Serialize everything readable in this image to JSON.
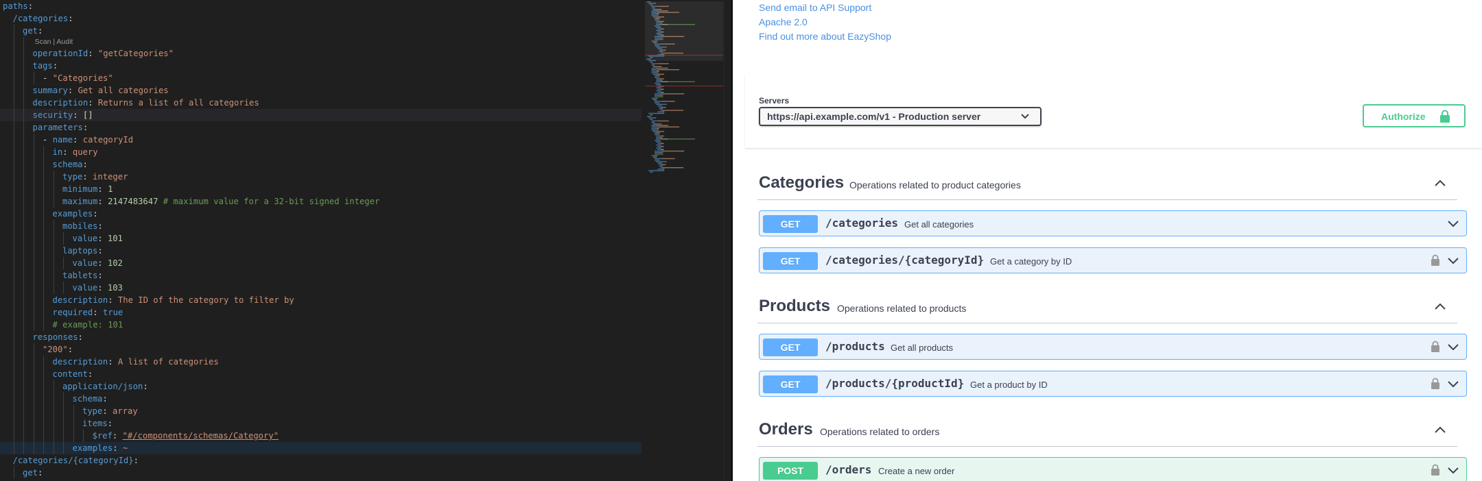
{
  "editor": {
    "codelens": "Scan | Audit",
    "lines": [
      {
        "indent": 0,
        "guides": [],
        "tokens": [
          [
            "k",
            "paths"
          ],
          [
            "p",
            ":"
          ]
        ]
      },
      {
        "indent": 1,
        "guides": [],
        "tokens": [
          [
            "k",
            "/categories"
          ],
          [
            "p",
            ":"
          ]
        ]
      },
      {
        "indent": 2,
        "guides": [
          1
        ],
        "tokens": [
          [
            "k",
            "get"
          ],
          [
            "p",
            ":"
          ]
        ]
      },
      {
        "codelens": true
      },
      {
        "indent": 3,
        "guides": [
          1,
          2
        ],
        "tokens": [
          [
            "k",
            "operationId"
          ],
          [
            "p",
            ": "
          ],
          [
            "s",
            "\"getCategories\""
          ]
        ]
      },
      {
        "indent": 3,
        "guides": [
          1,
          2
        ],
        "tokens": [
          [
            "k",
            "tags"
          ],
          [
            "p",
            ":"
          ]
        ]
      },
      {
        "indent": 4,
        "guides": [
          1,
          2,
          3
        ],
        "tokens": [
          [
            "p",
            "- "
          ],
          [
            "s",
            "\"Categories\""
          ]
        ]
      },
      {
        "indent": 3,
        "guides": [
          1,
          2
        ],
        "tokens": [
          [
            "k",
            "summary"
          ],
          [
            "p",
            ": "
          ],
          [
            "s",
            "Get all categories"
          ]
        ]
      },
      {
        "indent": 3,
        "guides": [
          1,
          2
        ],
        "tokens": [
          [
            "k",
            "description"
          ],
          [
            "p",
            ": "
          ],
          [
            "s",
            "Returns a list of all categories"
          ]
        ]
      },
      {
        "indent": 3,
        "guides": [
          1,
          2
        ],
        "hl": true,
        "tokens": [
          [
            "k",
            "security"
          ],
          [
            "p",
            ": "
          ],
          [
            "b",
            "[]"
          ]
        ]
      },
      {
        "indent": 3,
        "guides": [
          1,
          2
        ],
        "tokens": [
          [
            "k",
            "parameters"
          ],
          [
            "p",
            ":"
          ]
        ]
      },
      {
        "indent": 4,
        "guides": [
          1,
          2,
          3
        ],
        "tokens": [
          [
            "p",
            "- "
          ],
          [
            "k",
            "name"
          ],
          [
            "p",
            ": "
          ],
          [
            "s",
            "categoryId"
          ]
        ]
      },
      {
        "indent": 5,
        "guides": [
          1,
          2,
          3,
          4
        ],
        "tokens": [
          [
            "k",
            "in"
          ],
          [
            "p",
            ": "
          ],
          [
            "s",
            "query"
          ]
        ]
      },
      {
        "indent": 5,
        "guides": [
          1,
          2,
          3,
          4
        ],
        "tokens": [
          [
            "k",
            "schema"
          ],
          [
            "p",
            ":"
          ]
        ]
      },
      {
        "indent": 6,
        "guides": [
          1,
          2,
          3,
          4,
          5
        ],
        "tokens": [
          [
            "k",
            "type"
          ],
          [
            "p",
            ": "
          ],
          [
            "s",
            "integer"
          ]
        ]
      },
      {
        "indent": 6,
        "guides": [
          1,
          2,
          3,
          4,
          5
        ],
        "tokens": [
          [
            "k",
            "minimum"
          ],
          [
            "p",
            ": "
          ],
          [
            "n",
            "1"
          ]
        ]
      },
      {
        "indent": 6,
        "guides": [
          1,
          2,
          3,
          4,
          5
        ],
        "tokens": [
          [
            "k",
            "maximum"
          ],
          [
            "p",
            ": "
          ],
          [
            "n",
            "2147483647"
          ],
          [
            "p",
            " "
          ],
          [
            "c",
            "# maximum value for a 32-bit signed integer"
          ]
        ]
      },
      {
        "indent": 5,
        "guides": [
          1,
          2,
          3,
          4
        ],
        "tokens": [
          [
            "k",
            "examples"
          ],
          [
            "p",
            ":"
          ]
        ]
      },
      {
        "indent": 6,
        "guides": [
          1,
          2,
          3,
          4,
          5
        ],
        "tokens": [
          [
            "k",
            "mobiles"
          ],
          [
            "p",
            ":"
          ]
        ]
      },
      {
        "indent": 7,
        "guides": [
          1,
          2,
          3,
          4,
          5,
          6
        ],
        "tokens": [
          [
            "k",
            "value"
          ],
          [
            "p",
            ": "
          ],
          [
            "n",
            "101"
          ]
        ]
      },
      {
        "indent": 6,
        "guides": [
          1,
          2,
          3,
          4,
          5
        ],
        "tokens": [
          [
            "k",
            "laptops"
          ],
          [
            "p",
            ":"
          ]
        ]
      },
      {
        "indent": 7,
        "guides": [
          1,
          2,
          3,
          4,
          5,
          6
        ],
        "tokens": [
          [
            "k",
            "value"
          ],
          [
            "p",
            ": "
          ],
          [
            "n",
            "102"
          ]
        ]
      },
      {
        "indent": 6,
        "guides": [
          1,
          2,
          3,
          4,
          5
        ],
        "tokens": [
          [
            "k",
            "tablets"
          ],
          [
            "p",
            ":"
          ]
        ]
      },
      {
        "indent": 7,
        "guides": [
          1,
          2,
          3,
          4,
          5,
          6
        ],
        "tokens": [
          [
            "k",
            "value"
          ],
          [
            "p",
            ": "
          ],
          [
            "n",
            "103"
          ]
        ]
      },
      {
        "indent": 5,
        "guides": [
          1,
          2,
          3,
          4
        ],
        "tokens": [
          [
            "k",
            "description"
          ],
          [
            "p",
            ": "
          ],
          [
            "s",
            "The ID of the category to filter by"
          ]
        ]
      },
      {
        "indent": 5,
        "guides": [
          1,
          2,
          3,
          4
        ],
        "tokens": [
          [
            "k",
            "required"
          ],
          [
            "p",
            ": "
          ],
          [
            "k",
            "true"
          ]
        ]
      },
      {
        "indent": 5,
        "guides": [
          1,
          2,
          3,
          4
        ],
        "tokens": [
          [
            "c",
            "# example: 101"
          ]
        ]
      },
      {
        "indent": 3,
        "guides": [
          1,
          2
        ],
        "tokens": [
          [
            "k",
            "responses"
          ],
          [
            "p",
            ":"
          ]
        ]
      },
      {
        "indent": 4,
        "guides": [
          1,
          2,
          3
        ],
        "tokens": [
          [
            "s",
            "\"200\""
          ],
          [
            "p",
            ":"
          ]
        ]
      },
      {
        "indent": 5,
        "guides": [
          1,
          2,
          3,
          4
        ],
        "tokens": [
          [
            "k",
            "description"
          ],
          [
            "p",
            ": "
          ],
          [
            "s",
            "A list of categories"
          ]
        ]
      },
      {
        "indent": 5,
        "guides": [
          1,
          2,
          3,
          4
        ],
        "tokens": [
          [
            "k",
            "content"
          ],
          [
            "p",
            ":"
          ]
        ]
      },
      {
        "indent": 6,
        "guides": [
          1,
          2,
          3,
          4,
          5
        ],
        "tokens": [
          [
            "k",
            "application/json"
          ],
          [
            "p",
            ":"
          ]
        ]
      },
      {
        "indent": 7,
        "guides": [
          1,
          2,
          3,
          4,
          5,
          6
        ],
        "tokens": [
          [
            "k",
            "schema"
          ],
          [
            "p",
            ":"
          ]
        ]
      },
      {
        "indent": 8,
        "guides": [
          1,
          2,
          3,
          4,
          5,
          6,
          7
        ],
        "tokens": [
          [
            "k",
            "type"
          ],
          [
            "p",
            ": "
          ],
          [
            "s",
            "array"
          ]
        ]
      },
      {
        "indent": 8,
        "guides": [
          1,
          2,
          3,
          4,
          5,
          6,
          7
        ],
        "tokens": [
          [
            "k",
            "items"
          ],
          [
            "p",
            ":"
          ]
        ]
      },
      {
        "indent": 9,
        "guides": [
          1,
          2,
          3,
          4,
          5,
          6,
          7,
          8
        ],
        "tokens": [
          [
            "k",
            "$ref"
          ],
          [
            "p",
            ": "
          ],
          [
            "su",
            "\"#/components/schemas/Category\""
          ]
        ]
      },
      {
        "indent": 7,
        "guides": [
          1,
          2,
          3,
          4,
          5,
          6
        ],
        "cur": true,
        "tokens": [
          [
            "k",
            "examples"
          ],
          [
            "p",
            ": "
          ],
          [
            "s",
            "~"
          ]
        ]
      },
      {
        "indent": 1,
        "guides": [],
        "tokens": [
          [
            "k",
            "/categories/{categoryId}"
          ],
          [
            "p",
            ":"
          ]
        ]
      },
      {
        "indent": 2,
        "guides": [
          1
        ],
        "tokens": [
          [
            "k",
            "get"
          ],
          [
            "p",
            ":"
          ]
        ]
      }
    ]
  },
  "swagger": {
    "info_links": [
      "Send email to API Support",
      "Apache 2.0",
      "Find out more about EazyShop"
    ],
    "servers_label": "Servers",
    "server_selected": "https://api.example.com/v1 - Production server",
    "authorize_label": "Authorize",
    "tags": [
      {
        "name": "Categories",
        "description": "Operations related to product categories"
      },
      {
        "name": "Products",
        "description": "Operations related to products"
      },
      {
        "name": "Orders",
        "description": "Operations related to orders"
      }
    ],
    "operations": [
      {
        "method": "GET",
        "path": "/categories",
        "summary": "Get all categories",
        "locked": false
      },
      {
        "method": "GET",
        "path": "/categories/{categoryId}",
        "summary": "Get a category by ID",
        "locked": true
      },
      {
        "method": "GET",
        "path": "/products",
        "summary": "Get all products",
        "locked": true
      },
      {
        "method": "GET",
        "path": "/products/{productId}",
        "summary": "Get a product by ID",
        "locked": true
      },
      {
        "method": "POST",
        "path": "/orders",
        "summary": "Create a new order",
        "locked": true
      }
    ],
    "colors": {
      "get": "#61affe",
      "post": "#49cc90",
      "authorize": "#49cc90",
      "link": "#4990e2"
    }
  }
}
